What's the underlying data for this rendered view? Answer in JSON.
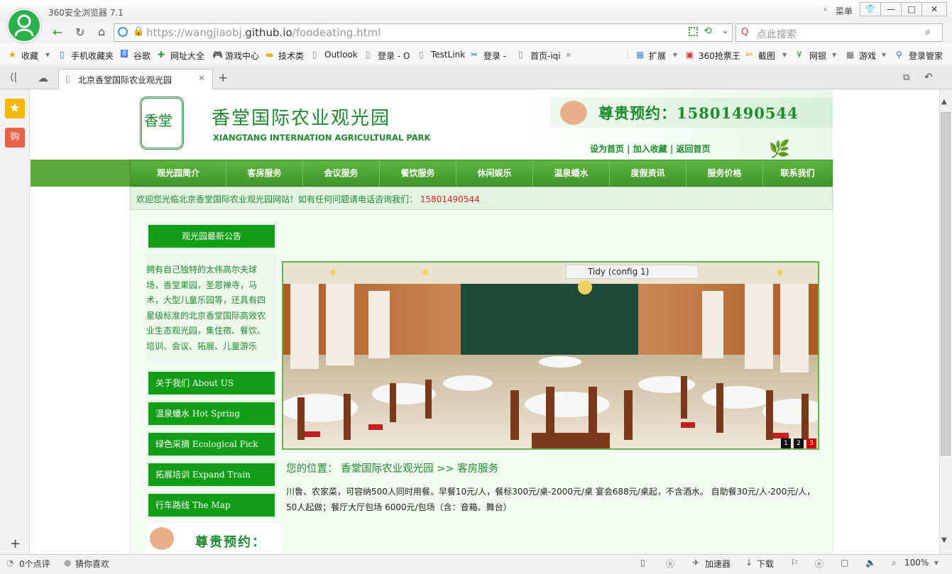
{
  "browser": {
    "app_name": "360安全浏览器 7.1",
    "menu_label": "菜单",
    "url_prefix": "https://wangjiaobj.",
    "url_domain": "github.io",
    "url_path": "/foodeating.html",
    "search_placeholder": "点此搜索",
    "bookmarks": [
      "收藏",
      "手机收藏夹",
      "谷歌",
      "网址大全",
      "游戏中心",
      "技术类",
      "Outlook",
      "登录 - O",
      "TestLink",
      "登录 -",
      "首页-iqi"
    ],
    "tools": [
      "扩展",
      "360抢票王",
      "截图",
      "网银",
      "游戏",
      "登录管家"
    ],
    "tab_title": "北京香堂国际农业观光园",
    "status": {
      "comments": "0个点评",
      "guess": "猜你喜欢",
      "accelerator": "加速器",
      "download": "下载",
      "zoom": "100%"
    }
  },
  "site": {
    "title_cn": "香堂国际农业观光园",
    "title_en": "XIANGTANG INTERNATION AGRICULTURAL PARK",
    "logo_chars": "香堂",
    "reservation": "尊贵预约：15801490544",
    "top_links": [
      "设为首页",
      "加入收藏",
      "返回首页"
    ],
    "nav": [
      "观光园简介",
      "客房服务",
      "会议服务",
      "餐饮服务",
      "休闲娱乐",
      "温泉蟠水",
      "度假资讯",
      "服务价格",
      "联系我们"
    ],
    "welcome": "欢迎您光临北京香堂国际农业观光园网站！如有任何问题请电话咨询我们：",
    "welcome_tel": "15801490544",
    "notice_title": "观光园最新公告",
    "notice_text": "拥有自己独特的太伟高尔夫球场，香堂果园，圣恩禅寺，马术，大型儿童乐园等，还具有四星级标准的北京香堂国际高效农业生态观光园，集住宿、餐饮、培训、会议、拓展、儿童游乐",
    "side_buttons": [
      "关于我们   About US",
      "温泉蟠水   Hot Spring",
      "绿色采摘   Ecological Pick",
      "拓展培训   Expand Train",
      "行车路线   The Map"
    ],
    "bottom_reservation": "尊贵预约：",
    "tooltip": "Tidy (config 1)",
    "slider_dots": [
      "1",
      "2",
      "3"
    ],
    "breadcrumb": "您的位置：  香堂国际农业观光园  >>  客房服务",
    "description": "川鲁、农家菜，可容纳500人同时用餐。早餐10元/人，餐标300元/桌-2000元/桌 宴会688元/桌起，不含酒水。 自助餐30元/人-200元/人，50人起做；餐厅大厅包场 6000元/包场（含：音箱、舞台）"
  }
}
